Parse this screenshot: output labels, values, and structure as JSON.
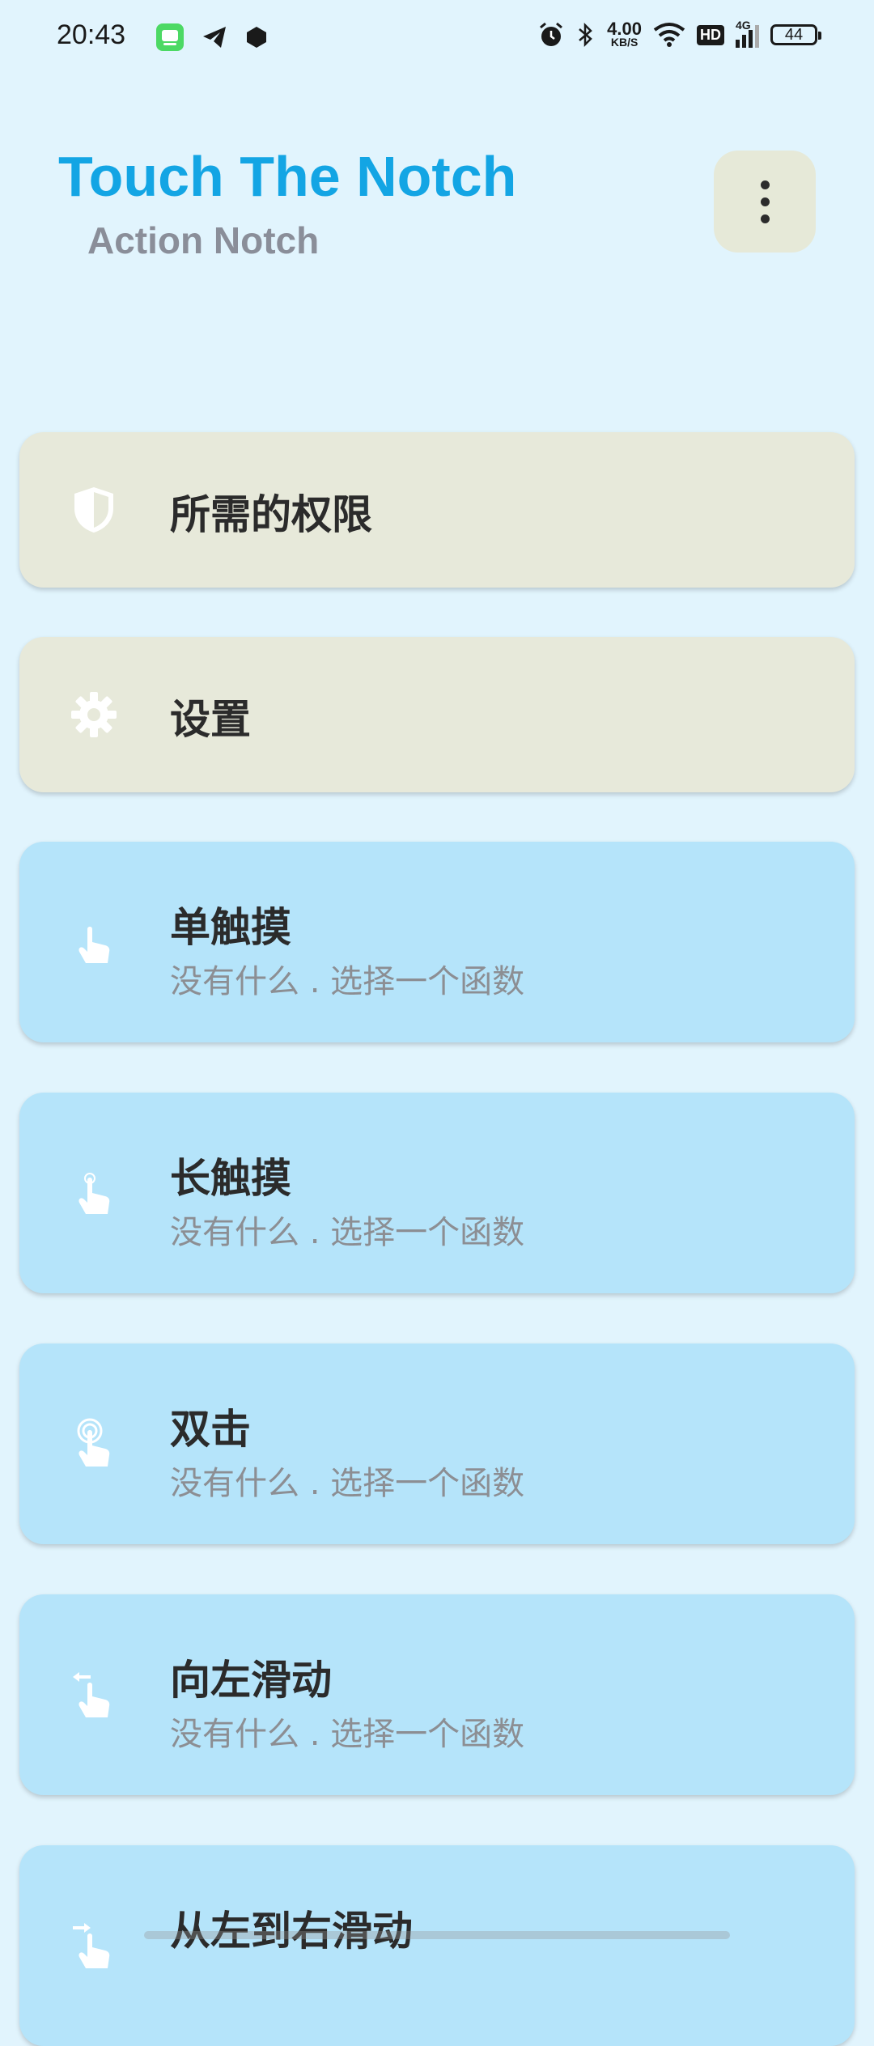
{
  "status_bar": {
    "time": "20:43",
    "speed_value": "4.00",
    "speed_unit": "KB/S",
    "hd": "HD",
    "network": "4G",
    "battery": "44"
  },
  "header": {
    "title": "Touch The Notch",
    "subtitle": "Action Notch"
  },
  "cards": [
    {
      "label": "所需的权限",
      "icon": "shield-icon"
    },
    {
      "label": "设置",
      "icon": "gear-icon"
    },
    {
      "label": "单触摸",
      "description": "没有什么 . 选择一个函数",
      "icon": "tap-icon"
    },
    {
      "label": "长触摸",
      "description": "没有什么 . 选择一个函数",
      "icon": "long-press-icon"
    },
    {
      "label": "双击",
      "description": "没有什么 . 选择一个函数",
      "icon": "double-tap-icon"
    },
    {
      "label": "向左滑动",
      "description": "没有什么 . 选择一个函数",
      "icon": "swipe-left-icon"
    },
    {
      "label": "从左到右滑动",
      "icon": "swipe-right-icon"
    }
  ],
  "colors": {
    "background": "#E1F4FD",
    "title": "#13A5E4",
    "beige_card": "#E7E9DA",
    "blue_card": "#B5E4FA"
  }
}
